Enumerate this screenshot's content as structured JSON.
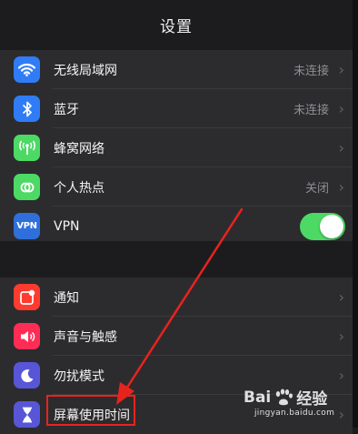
{
  "header": {
    "title": "设置"
  },
  "colors": {
    "wifi": "#2f7cf6",
    "bluetooth": "#2f7cf6",
    "cellular": "#4cd964",
    "hotspot": "#4cd964",
    "vpn": "#2f6fdb",
    "notifications": "#ff3b30",
    "sounds": "#ff2d55",
    "dnd": "#5856d6",
    "screentime": "#5856d6",
    "toggle_on": "#4cd964",
    "annotation": "#e8231e"
  },
  "group1": {
    "items": [
      {
        "icon": "wifi-icon",
        "label": "无线局域网",
        "value": "未连接"
      },
      {
        "icon": "bluetooth-icon",
        "label": "蓝牙",
        "value": "未连接"
      },
      {
        "icon": "cellular-icon",
        "label": "蜂窝网络",
        "value": ""
      },
      {
        "icon": "hotspot-icon",
        "label": "个人热点",
        "value": "关闭"
      },
      {
        "icon": "vpn-icon",
        "label": "VPN",
        "icon_text": "VPN",
        "toggle_on": true
      }
    ]
  },
  "group2": {
    "items": [
      {
        "icon": "notifications-icon",
        "label": "通知"
      },
      {
        "icon": "sounds-icon",
        "label": "声音与触感"
      },
      {
        "icon": "moon-icon",
        "label": "勿扰模式"
      },
      {
        "icon": "hourglass-icon",
        "label": "屏幕使用时间"
      }
    ]
  },
  "watermark": {
    "brand": "Bai",
    "brand2": "经验",
    "url": "jingyan.baidu.com"
  }
}
